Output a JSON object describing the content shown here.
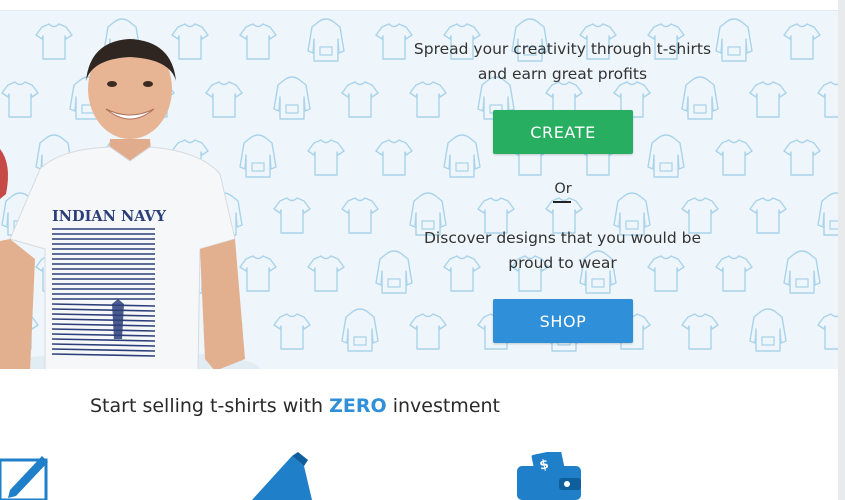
{
  "hero": {
    "tagline_line1": "Spread your creativity through t-shirts",
    "tagline_line2": "and earn great profits",
    "create_label": "CREATE",
    "or_label": "Or",
    "discover_line1": "Discover designs that you would be",
    "discover_line2": "proud to wear",
    "shop_label": "SHOP",
    "shirt_print": "INDIAN NAVY"
  },
  "features": {
    "title_prefix": "Start selling t-shirts with",
    "title_highlight": "ZERO",
    "title_suffix": "investment",
    "icons": [
      "design-pencil-icon",
      "megaphone-icon",
      "wallet-icon"
    ]
  },
  "colors": {
    "create": "#27ae60",
    "shop": "#2f8fd8",
    "highlight": "#2f8fd8",
    "hero_bg": "#eef6fb"
  }
}
